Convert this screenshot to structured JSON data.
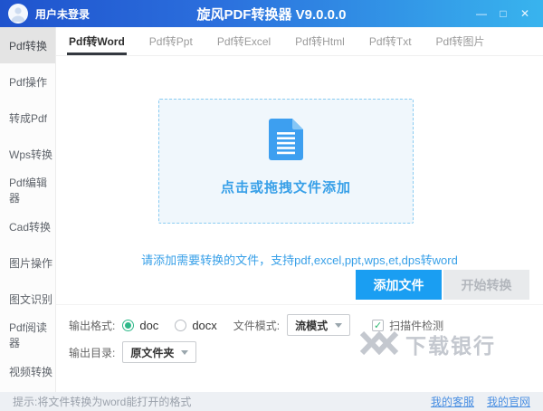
{
  "titlebar": {
    "user_status": "用户未登录",
    "title": "旋风PDF转换器 V9.0.0.0",
    "controls": {
      "minimize": "—",
      "maximize": "□",
      "close": "✕"
    }
  },
  "sidebar": {
    "items": [
      {
        "label": "Pdf转换",
        "active": true
      },
      {
        "label": "Pdf操作",
        "active": false
      },
      {
        "label": "转成Pdf",
        "active": false
      },
      {
        "label": "Wps转换",
        "active": false
      },
      {
        "label": "Pdf编辑器",
        "active": false
      },
      {
        "label": "Cad转换",
        "active": false
      },
      {
        "label": "图片操作",
        "active": false
      },
      {
        "label": "图文识别",
        "active": false
      },
      {
        "label": "Pdf阅读器",
        "active": false
      },
      {
        "label": "视频转换",
        "active": false
      }
    ]
  },
  "tabs": [
    {
      "label": "Pdf转Word",
      "active": true
    },
    {
      "label": "Pdf转Ppt",
      "active": false
    },
    {
      "label": "Pdf转Excel",
      "active": false
    },
    {
      "label": "Pdf转Html",
      "active": false
    },
    {
      "label": "Pdf转Txt",
      "active": false
    },
    {
      "label": "Pdf转图片",
      "active": false
    }
  ],
  "dropzone": {
    "icon": "document-icon",
    "label": "点击或拖拽文件添加"
  },
  "hint": "请添加需要转换的文件，支持pdf,excel,ppt,wps,et,dps转word",
  "actions": {
    "add_files": "添加文件",
    "start_convert": "开始转换"
  },
  "options": {
    "output_format_label": "输出格式:",
    "format_doc": "doc",
    "format_doc_selected": true,
    "format_docx": "docx",
    "format_docx_selected": false,
    "file_mode_label": "文件模式:",
    "file_mode_value": "流模式",
    "scan_detect_label": "扫描件检测",
    "scan_detect_checked": true,
    "scan_check_glyph": "✓",
    "output_dir_label": "输出目录:",
    "output_dir_value": "原文件夹"
  },
  "watermark": {
    "brand": "下载银行"
  },
  "statusbar": {
    "tip": "提示:将文件转换为word能打开的格式",
    "links": [
      {
        "label": "我的客服"
      },
      {
        "label": "我的官网"
      }
    ]
  },
  "colors": {
    "titlebar_gradient_start": "#1f53cd",
    "titlebar_gradient_end": "#38b4ee",
    "accent_blue": "#1a9ef2",
    "dropzone_blue": "#38a0e8",
    "radio_check_green": "#2eb889",
    "watermark_gray": "#c4c8cf"
  }
}
